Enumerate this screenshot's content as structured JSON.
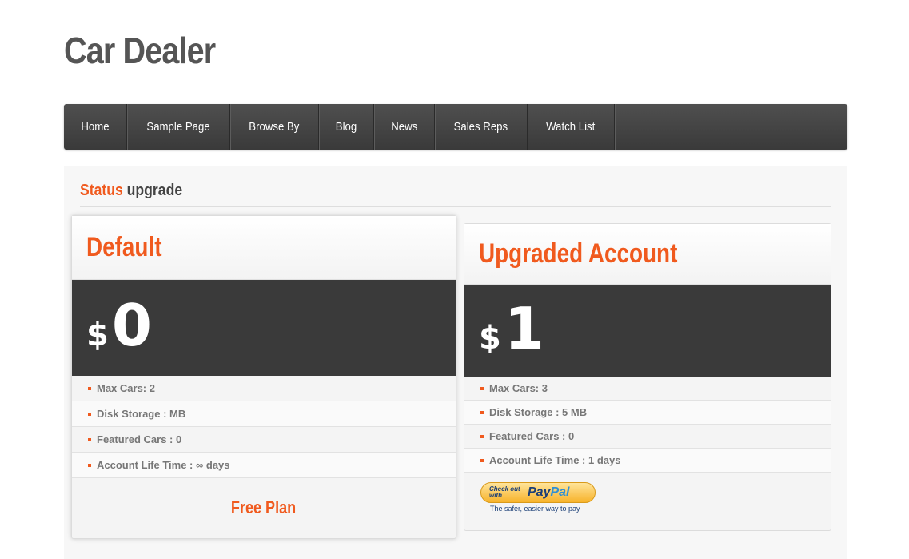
{
  "site": {
    "title": "Car Dealer"
  },
  "nav": {
    "items": [
      {
        "label": "Home"
      },
      {
        "label": "Sample Page"
      },
      {
        "label": "Browse By"
      },
      {
        "label": "Blog"
      },
      {
        "label": "News"
      },
      {
        "label": "Sales Reps"
      },
      {
        "label": "Watch List"
      }
    ]
  },
  "section": {
    "title_accent": "Status",
    "title_rest": "upgrade"
  },
  "plans": [
    {
      "name": "Default",
      "currency": "$",
      "price": "0",
      "features": [
        "Max Cars: 2",
        "Disk Storage : MB",
        "Featured Cars : 0",
        "Account Life Time : ∞ days"
      ],
      "footer_label": "Free Plan"
    },
    {
      "name": "Upgraded Account",
      "currency": "$",
      "price": "1",
      "features": [
        "Max Cars: 3",
        "Disk Storage : 5 MB",
        "Featured Cars : 0",
        "Account Life Time : 1 days"
      ],
      "paypal": {
        "check_out": "Check out with",
        "logo_pay": "Pay",
        "logo_pal": "Pal",
        "tagline": "The safer, easier way to pay"
      }
    }
  ],
  "colors": {
    "accent": "#f05a1e",
    "nav_bg": "#444444",
    "price_bg": "#3a3a3a"
  }
}
